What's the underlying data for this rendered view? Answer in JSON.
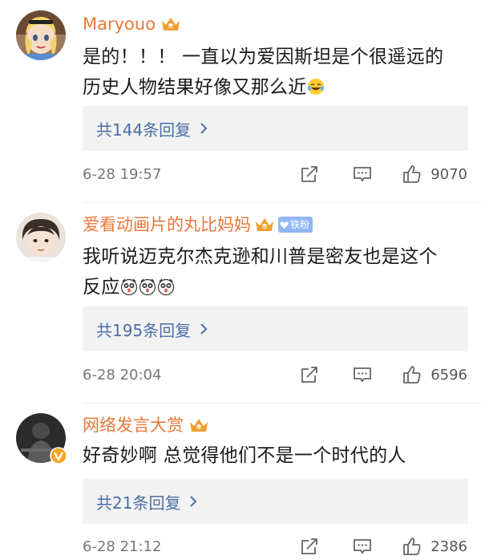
{
  "comments": [
    {
      "username": "Maryouo",
      "lines": [
        "是的！！！ 一直以为爱因斯坦是个很遥远的",
        "历史人物结果好像又那么近"
      ],
      "emoji": [
        "laugh-cry-emoji"
      ],
      "replies_label": "共144条回复",
      "time": "6-28 19:57",
      "likes": "9070",
      "fan_badge": ""
    },
    {
      "username": "爱看动画片的丸比妈妈",
      "lines": [
        "我听说迈克尔杰克逊和川普是密友也是这个",
        "反应"
      ],
      "emoji": [
        "shocked-emoji",
        "shocked-emoji",
        "shocked-emoji"
      ],
      "replies_label": "共195条回复",
      "time": "6-28 20:04",
      "likes": "6596",
      "fan_badge": "铁粉"
    },
    {
      "username": "网络发言大赏",
      "lines": [
        "好奇妙啊 总觉得他们不是一个时代的人"
      ],
      "emoji": [],
      "replies_label": "共21条回复",
      "time": "6-28 21:12",
      "likes": "2386",
      "fan_badge": ""
    }
  ],
  "colors": {
    "username": "#e8783a",
    "reply_link": "#4a6fa5",
    "reply_bg": "#f2f2f2",
    "crown": "#f0a030",
    "fan_badge": "#8fb7f3",
    "verified": "#f5a623"
  }
}
